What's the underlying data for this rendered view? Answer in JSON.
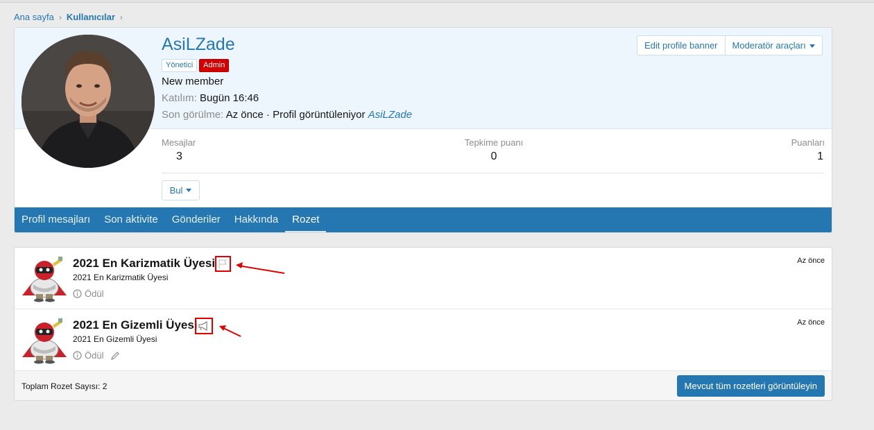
{
  "breadcrumb": {
    "home": "Ana sayfa",
    "current": "Kullanıcılar"
  },
  "profile": {
    "username": "AsiLZade",
    "banners": [
      "Yönetici",
      "Admin"
    ],
    "user_title": "New member",
    "joined_label": "Katılım:",
    "joined_value": "Bugün 16:46",
    "lastseen_label": "Son görülme:",
    "lastseen_value": "Az önce · Profil görüntüleniyor",
    "lastseen_link": "AsiLZade",
    "buttons": {
      "edit_banner": "Edit profile banner",
      "moderator_tools": "Moderatör araçları"
    },
    "stats": [
      {
        "label": "Mesajlar",
        "value": "3"
      },
      {
        "label": "Tepkime puanı",
        "value": "0"
      },
      {
        "label": "Puanları",
        "value": "1"
      }
    ],
    "find_button": "Bul",
    "tabs": [
      "Profil mesajları",
      "Son aktivite",
      "Gönderiler",
      "Hakkında",
      "Rozet"
    ],
    "active_tab": "Rozet"
  },
  "badges": {
    "items": [
      {
        "title": "2021 En Karizmatik Üyesi",
        "description": "2021 En Karizmatik Üyesi",
        "category": "Ödül",
        "time": "Az önce",
        "icon": "flag-icon"
      },
      {
        "title": "2021 En Gizemli Üyesi",
        "description": "2021 En Gizemli Üyesi",
        "category": "Ödül",
        "time": "Az önce",
        "icon": "megaphone-icon"
      }
    ],
    "total_label": "Toplam Rozet Sayısı: 2",
    "view_all_button": "Mevcut tüm rozetleri görüntüleyin"
  },
  "colors": {
    "accent": "#2577b1",
    "admin_banner": "#d40000",
    "annotation": "#e00000"
  }
}
